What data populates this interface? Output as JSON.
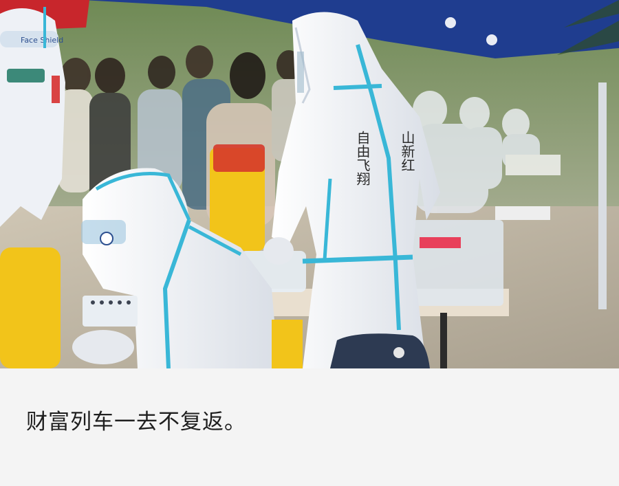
{
  "photo": {
    "subject": "",
    "suit_text_left": "自由飞翔",
    "suit_text_right": "山新红",
    "suit_text_front": "",
    "face_shield_label": "Face Shield"
  },
  "caption": {
    "text": "财富列车一去不复返。"
  },
  "colors": {
    "suit": "#f2f4f7",
    "tape": "#39b7d7",
    "tent": "#1f3d8f",
    "bin": "#f2c41a",
    "background": "#f4f4f4",
    "caption_text": "#1f1f1f"
  }
}
